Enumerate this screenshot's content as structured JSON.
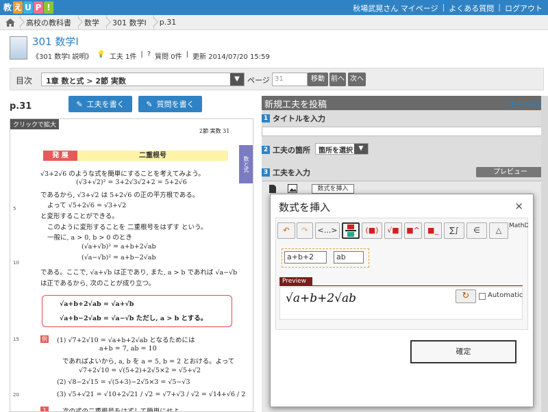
{
  "header": {
    "logo_letters": [
      "教",
      "え",
      "U",
      "P",
      "!"
    ],
    "logo_colors": [
      "#2f83c5",
      "#e8a030",
      "#3fb0e0",
      "#f07090",
      "#8ac53a"
    ],
    "user_link": "秋場武晃さん マイページ",
    "faq_link": "よくある質問",
    "logout_link": "ログアウト"
  },
  "breadcrumb": {
    "items": [
      "高校の教科書",
      "数学",
      "301 数学Ⅰ",
      "p.31"
    ]
  },
  "book": {
    "title": "301 数学Ⅰ",
    "code": "《301 数学Ⅰ 説明》",
    "kufuu_count": "工夫 1件",
    "question_count": "質問 0件",
    "updated": "更新 2014/07/20 15:59"
  },
  "toc": {
    "label": "目次",
    "selected": "1章 数と式 > 2節 実数",
    "page_label": "ページ",
    "page_value": "31",
    "move_btn": "移動",
    "prev_btn": "前へ",
    "next_btn": "次へ"
  },
  "viewer": {
    "page_num": "p.31",
    "write_kufuu_btn": "工夫を書く",
    "write_question_btn": "質問を書く",
    "zoom_tag": "クリックで拡大",
    "header_text": "2節 実数 31",
    "hatten": "発 展",
    "section_title": "二重根号",
    "side_tab": "数と式",
    "lines": [
      "√3+2√6 のような式を簡単にすることを考えてみよう。",
      "(√3+√2)² = 3+2√3√2+2 = 5+2√6",
      "であるから, √3+√2 は 5+2√6 の正の平方根である。",
      "よって        √5+2√6 = √3+√2",
      "と変形することができる。",
      "このように変形することを 二重根号をはずす という。",
      "一般に, a > 0, b > 0 のとき",
      "(√a+√b)² = a+b+2√ab",
      "(√a−√b)² = a+b−2√ab",
      "である。ここで, √a+√b は正であり, また, a > b であれば √a−√b",
      "は正であるから, 次のことが成り立つ。",
      "√a+b+2√ab = √a+√b",
      "√a+b−2√ab = √a−√b        ただし, a > b とする。",
      "(1)  √7+2√10 = √a+b+2√ab となるためには",
      "a+b = 7,   ab = 10",
      "であればよいから, a, b を a = 5, b = 2 とおける。よって",
      "√7+2√10 = √(5+2)+2√5×2 = √5+√2",
      "(2)  √8−2√15 = √(5+3)−2√5×3 = √5−√3",
      "(3)  √5+√21 = √10+2√21 / √2 = √7+√3 / √2 = √14+√6 / 2",
      "次の式の二重根号をはずして簡単にせよ。"
    ],
    "line_numbers": [
      "5",
      "10",
      "15",
      "20"
    ],
    "ex_tags": [
      "例1",
      "1"
    ]
  },
  "panel": {
    "title": "新規工夫を投稿",
    "cancel": "キャンセル",
    "step1": "タイトルを入力",
    "step2": "工夫の箇所",
    "step2_select": "箇所を選択",
    "step3": "工夫を入力",
    "preview_btn": "プレビュー",
    "insert_btn": "数式を挿入"
  },
  "modal": {
    "title": "数式を挿入",
    "close": "×",
    "tools": [
      "↶",
      "↷",
      "<...>",
      "frac",
      "(■)",
      "√■",
      "■^",
      "■_",
      "∑∫",
      "∈",
      "△"
    ],
    "field1": "a+b+2",
    "field2": "ab",
    "preview_label": "Preview",
    "preview_formula": "√a+b+2√ab",
    "refresh": "↻",
    "automatic": "Automatic",
    "confirm": "確定",
    "brand": "MathDoxMa"
  }
}
